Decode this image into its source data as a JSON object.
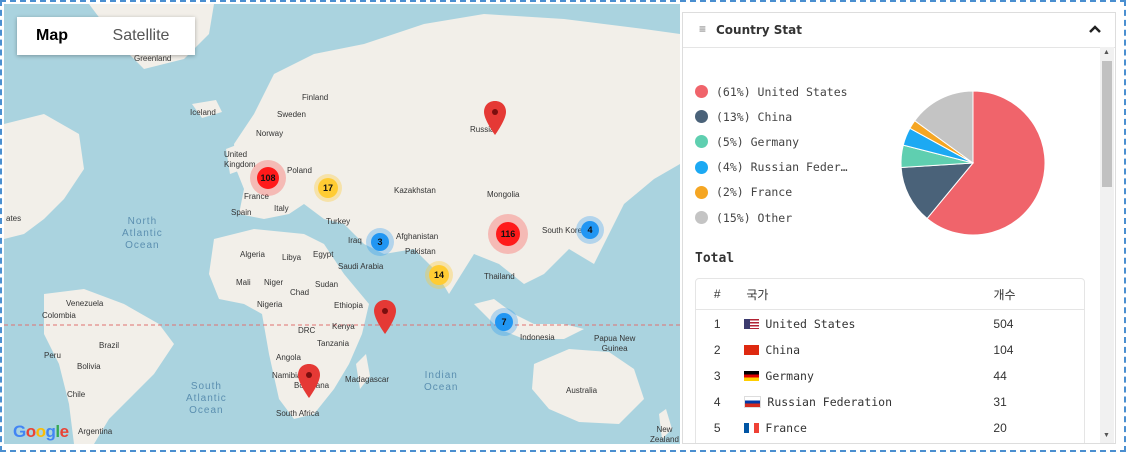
{
  "map": {
    "type_control": {
      "map_label": "Map",
      "satellite_label": "Satellite"
    },
    "labels": {
      "greenland": "Greenland",
      "iceland": "Iceland",
      "finland": "Finland",
      "sweden": "Sweden",
      "norway": "Norway",
      "united_kingdom": "United\nKingdom",
      "poland": "Poland",
      "france": "France",
      "spain": "Spain",
      "italy": "Italy",
      "ukraine": "Ukraine",
      "turkey": "Turkey",
      "kazakhstan": "Kazakhstan",
      "mongolia": "Mongolia",
      "russia": "Russia",
      "iraq": "Iraq",
      "afghanistan": "Afghanistan",
      "pakistan": "Pakistan",
      "saudi_arabia": "Saudi Arabia",
      "china": "China",
      "japan": "Japan",
      "south_korea": "South Korea",
      "thailand": "Thailand",
      "indonesia": "Indonesia",
      "papua": "Papua New\nGuinea",
      "australia": "Australia",
      "new_zealand": "New\nZealand",
      "algeria": "Algeria",
      "libya": "Libya",
      "egypt": "Egypt",
      "mali": "Mali",
      "niger": "Niger",
      "chad": "Chad",
      "sudan": "Sudan",
      "nigeria": "Nigeria",
      "ethiopia": "Ethiopia",
      "kenya": "Kenya",
      "drc": "DRC",
      "tanzania": "Tanzania",
      "angola": "Angola",
      "namibia": "Namibia",
      "botswana": "Botswana",
      "madagascar": "Madagascar",
      "south_africa": "South Africa",
      "venezuela": "Venezuela",
      "colombia": "Colombia",
      "peru": "Peru",
      "brazil": "Brazil",
      "bolivia": "Bolivia",
      "chile": "Chile",
      "argentina": "Argentina",
      "states": "ates"
    },
    "oceans": {
      "north_atlantic": "North\nAtlantic\nOcean",
      "south_atlantic": "South\nAtlantic\nOcean",
      "indian": "Indian\nOcean"
    },
    "clusters": [
      {
        "id": "europe",
        "count": "108",
        "color": "#ff1a1a"
      },
      {
        "id": "east-europe",
        "count": "17",
        "color": "#ffcc33"
      },
      {
        "id": "middle-east",
        "count": "3",
        "color": "#2196f3"
      },
      {
        "id": "china",
        "count": "116",
        "color": "#ff1a1a"
      },
      {
        "id": "korea",
        "count": "4",
        "color": "#2196f3"
      },
      {
        "id": "india",
        "count": "14",
        "color": "#ffcc33"
      },
      {
        "id": "indonesia",
        "count": "7",
        "color": "#2196f3"
      }
    ],
    "google": [
      "G",
      "o",
      "o",
      "g",
      "l",
      "e"
    ]
  },
  "panel": {
    "title": "Country Stat",
    "legend": [
      {
        "label": "(61%) United States",
        "color": "#f0646b"
      },
      {
        "label": "(13%) China",
        "color": "#4a6279"
      },
      {
        "label": "(5%) Germany",
        "color": "#5fcfb0"
      },
      {
        "label": "(4%) Russian Feder…",
        "color": "#1ca9f3"
      },
      {
        "label": "(2%) France",
        "color": "#f5a623"
      },
      {
        "label": "(15%) Other",
        "color": "#c4c4c4"
      }
    ],
    "pie": {
      "values": [
        61,
        13,
        5,
        4,
        2,
        15
      ]
    },
    "total_label": "Total",
    "table": {
      "headers": {
        "num": "#",
        "country": "국가",
        "count": "개수"
      },
      "rows": [
        {
          "num": "1",
          "country": "United States",
          "count": "504",
          "flag": "us"
        },
        {
          "num": "2",
          "country": "China",
          "count": "104",
          "flag": "cn"
        },
        {
          "num": "3",
          "country": "Germany",
          "count": "44",
          "flag": "de"
        },
        {
          "num": "4",
          "country": "Russian Federation",
          "count": "31",
          "flag": "ru"
        },
        {
          "num": "5",
          "country": "France",
          "count": "20",
          "flag": "fr"
        }
      ]
    }
  }
}
